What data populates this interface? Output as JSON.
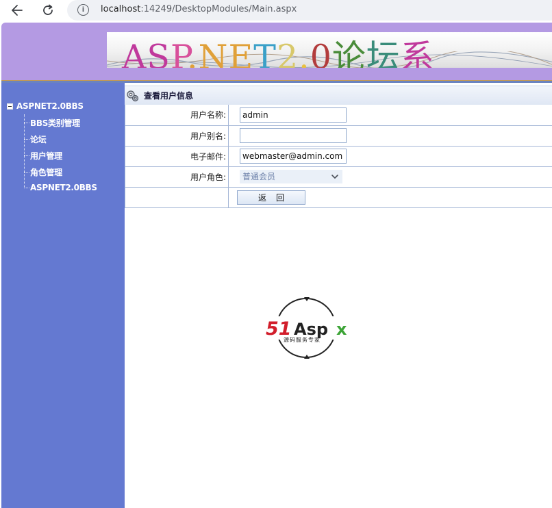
{
  "browser": {
    "back_icon": "arrow-left-icon",
    "reload_icon": "reload-icon",
    "info_icon": "info-icon",
    "url_host": "localhost",
    "url_rest": ":14249/DesktopModules/Main.aspx"
  },
  "header": {
    "banner_text": "ASP.NET2.0论坛系"
  },
  "sidebar": {
    "root_label": "ASPNET2.0BBS",
    "items": [
      {
        "label": "BBS类别管理"
      },
      {
        "label": "论坛"
      },
      {
        "label": "用户管理"
      },
      {
        "label": "角色管理"
      },
      {
        "label": "ASPNET2.0BBS"
      }
    ]
  },
  "content": {
    "section_title": "查看用户信息",
    "fields": {
      "username_label": "用户名称:",
      "username_value": "admin",
      "alias_label": "用户别名:",
      "alias_value": "",
      "email_label": "电子邮件:",
      "email_value": "webmaster@admin.com",
      "role_label": "用户角色:",
      "role_value": "普通会员"
    },
    "return_button": "返回"
  },
  "logo": {
    "brand": "51Aspx",
    "tagline": "源码服务专家"
  },
  "colors": {
    "header_bg": "#b49ae3",
    "sidebar_bg": "#6479d1",
    "table_border": "#a4b6d6"
  }
}
